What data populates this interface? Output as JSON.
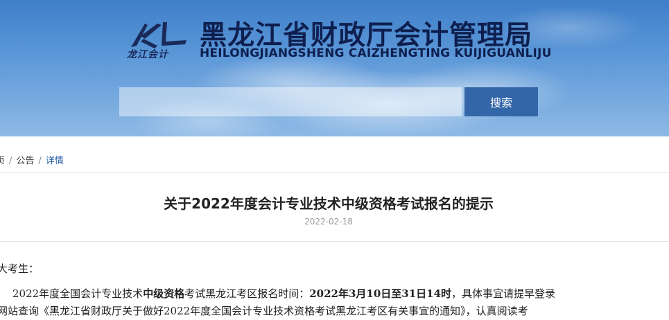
{
  "header": {
    "logo_text": "龙江会计",
    "title_cn": "黑龙江省财政厅会计管理局",
    "title_en": "HEILONGJIANGSHENG CAIZHENGTING KUIJIGUANLIJU"
  },
  "search": {
    "placeholder": "",
    "button_label": "搜索"
  },
  "breadcrumb": {
    "items": [
      "页",
      "公告",
      "详情"
    ],
    "separator": "/"
  },
  "article": {
    "title": "关于2022年度会计专业技术中级资格考试报名的提示",
    "date": "2022-02-18",
    "greeting": "大考生：",
    "line1": {
      "part1": "2022年度全国会计专业技术",
      "bold1": "中级资格",
      "part2": "考试黑龙江考区报名时间：",
      "bold2": "2022年3月10日至31日14时",
      "part3": "，具体事宜请提早登录"
    },
    "line2": "网站查询《黑龙江省财政厅关于做好2022年度全国会计专业技术资格考试黑龙江考区有关事宜的通知》，认真阅读考"
  },
  "colors": {
    "button_bg": "#3366a8",
    "breadcrumb_current": "#1f5aa6",
    "title_text": "#0e1f4f"
  }
}
